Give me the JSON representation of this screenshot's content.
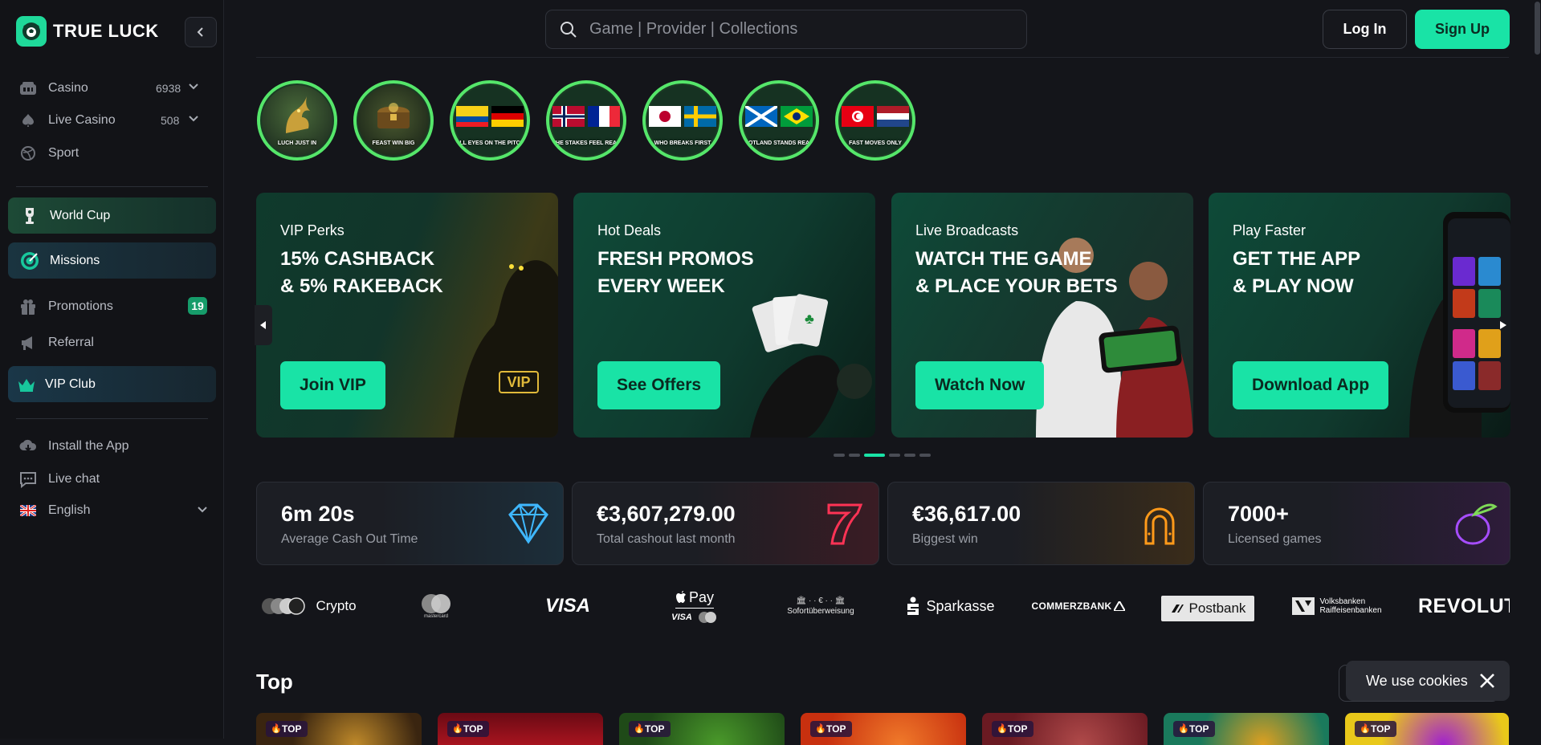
{
  "brand": {
    "name": "TRUE LUCK"
  },
  "search": {
    "placeholder": "Game | Provider | Collections"
  },
  "auth": {
    "login_label": "Log In",
    "signup_label": "Sign Up"
  },
  "sidebar": {
    "items": [
      {
        "label": "Casino",
        "count": "6938",
        "icon": "casino-icon"
      },
      {
        "label": "Live Casino",
        "count": "508",
        "icon": "spade-icon"
      },
      {
        "label": "Sport",
        "icon": "ball-icon"
      }
    ],
    "highlights": [
      {
        "label": "World Cup",
        "icon": "trophy-icon"
      },
      {
        "label": "Missions",
        "icon": "target-icon"
      }
    ],
    "secondary": [
      {
        "label": "Promotions",
        "badge": "19",
        "icon": "gift-icon"
      },
      {
        "label": "Referral",
        "icon": "megaphone-icon"
      }
    ],
    "vip": {
      "label": "VIP Club",
      "icon": "crown-icon"
    },
    "footer": [
      {
        "label": "Install the App",
        "icon": "cloud-download-icon"
      },
      {
        "label": "Live chat",
        "icon": "chat-icon"
      },
      {
        "label": "English",
        "icon": "uk-flag-icon"
      }
    ]
  },
  "stories": [
    {
      "caption": "LUCH JUST IN",
      "theme": "dragon"
    },
    {
      "caption": "FEAST WIN BIG",
      "theme": "chest"
    },
    {
      "caption": "ALL EYES ON THE PITCH",
      "theme": "flags"
    },
    {
      "caption": "THE STAKES FEEL REAL",
      "theme": "flags"
    },
    {
      "caption": "WHO BREAKS FIRST",
      "theme": "flags"
    },
    {
      "caption": "SCOTLAND STANDS READY",
      "theme": "flags"
    },
    {
      "caption": "FAST MOVES ONLY",
      "theme": "flags"
    }
  ],
  "promos": [
    {
      "eyebrow": "VIP Perks",
      "headline": "15% CASHBACK\n& 5% RAKEBACK",
      "cta": "Join VIP",
      "image_text": "VIP"
    },
    {
      "eyebrow": "Hot Deals",
      "headline": "FRESH PROMOS\nEVERY WEEK",
      "cta": "See Offers"
    },
    {
      "eyebrow": "Live Broadcasts",
      "headline": "WATCH THE GAME\n& PLACE YOUR BETS",
      "cta": "Watch Now"
    },
    {
      "eyebrow": "Play Faster",
      "headline": "GET THE APP\n& PLAY NOW",
      "cta": "Download App"
    }
  ],
  "carousel": {
    "active_index": 2,
    "total": 6
  },
  "stats": [
    {
      "value": "6m 20s",
      "label": "Average Cash Out Time",
      "icon": "diamond-icon",
      "color": "#3fb8ff"
    },
    {
      "value": "€3,607,279.00",
      "label": "Total cashout last month",
      "icon": "seven-icon",
      "color": "#ff3355"
    },
    {
      "value": "€36,617.00",
      "label": "Biggest win",
      "icon": "horseshoe-icon",
      "color": "#ff9a1a"
    },
    {
      "value": "7000+",
      "label": "Licensed games",
      "icon": "plum-icon",
      "color": "#a64dff"
    }
  ],
  "payments": {
    "crypto": "Crypto",
    "mastercard": "mastercard",
    "visa": "VISA",
    "applepay": "Pay",
    "applepay_visa": "VISA",
    "sofort": "Sofortüberweisung",
    "sparkasse": "Sparkasse",
    "commerzbank": "COMMERZBANK",
    "postbank": "Postbank",
    "volksbanken_1": "Volksbanken",
    "volksbanken_2": "Raiffeisenbanken",
    "revolut": "REVOLUT"
  },
  "section": {
    "title": "Top"
  },
  "tiles": [
    {
      "badge": "TOP",
      "color": "#3a2510"
    },
    {
      "badge": "TOP",
      "color": "#8a0f1d"
    },
    {
      "badge": "TOP",
      "color": "#1f5a18"
    },
    {
      "badge": "TOP",
      "color": "#d23a12"
    },
    {
      "badge": "TOP",
      "color": "#7a1a22"
    },
    {
      "badge": "TOP",
      "color": "#1a7a5c"
    },
    {
      "badge": "TOP",
      "color": "#e9c81a"
    }
  ],
  "cookie": {
    "text": "We use cookies"
  }
}
